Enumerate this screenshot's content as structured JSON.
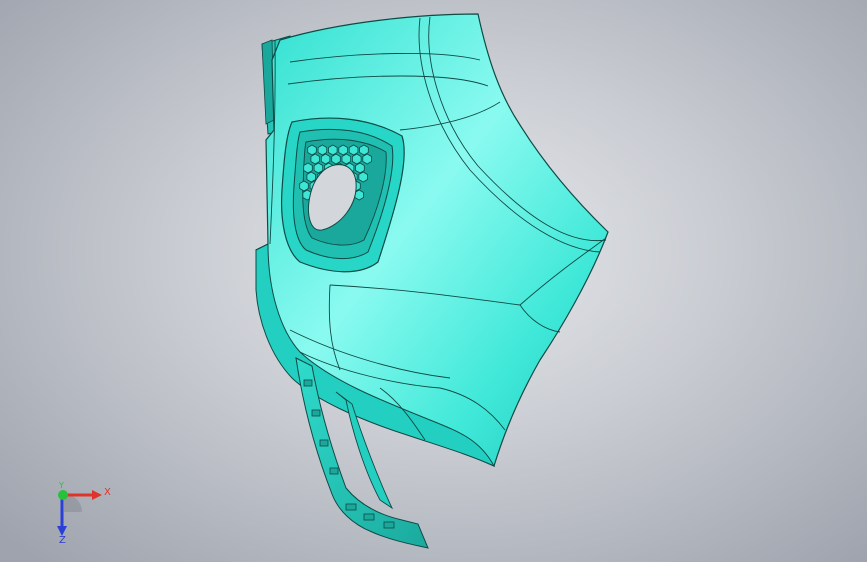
{
  "viewport": {
    "background_top": "#e6e8eb",
    "background_edge": "#9ea3ad"
  },
  "model": {
    "name_icon": "bumper-cover-3d-model",
    "fill_light": "#7ff7ea",
    "fill_mid": "#33e6d6",
    "fill_dark": "#16b3a6",
    "edge_color": "#0f4a45"
  },
  "triad": {
    "x_label": "X",
    "y_label": "Y",
    "z_label": "Z",
    "x_color": "#e0342b",
    "y_color": "#27c23a",
    "z_color": "#2a3fd6"
  }
}
